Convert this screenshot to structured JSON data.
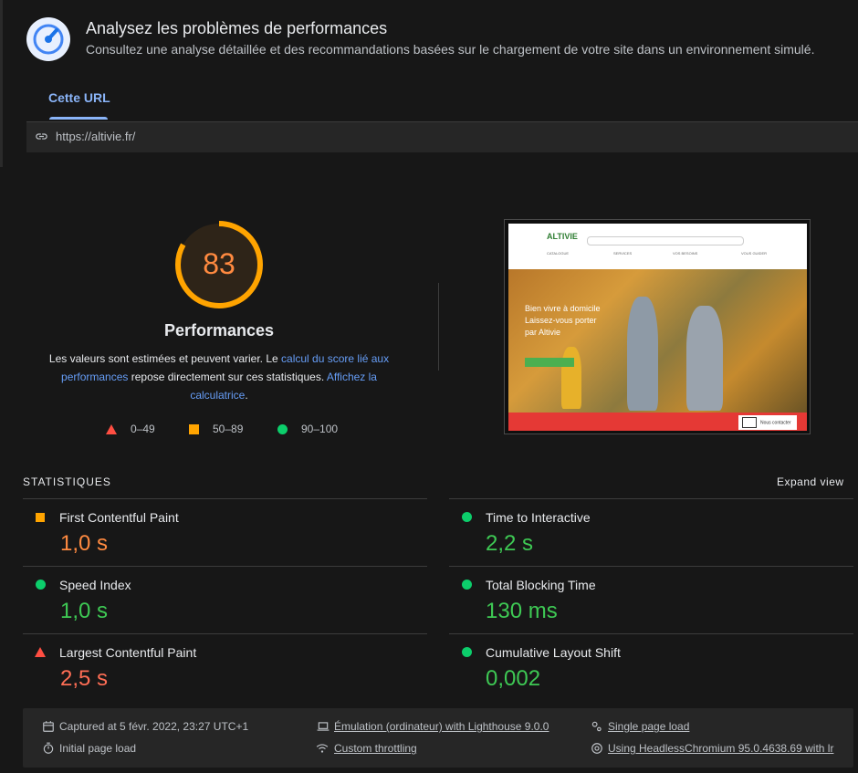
{
  "header": {
    "title": "Analysez les problèmes de performances",
    "subtitle": "Consultez une analyse détaillée et des recommandations basées sur le chargement de votre site dans un environnement simulé."
  },
  "tabs": [
    {
      "label": "Cette URL"
    }
  ],
  "url": "https://altivie.fr/",
  "score": {
    "value": "83",
    "fraction": 0.83,
    "label": "Performances",
    "desc_part1": "Les valeurs sont estimées et peuvent varier. Le ",
    "desc_link1": "calcul du score lié aux performances",
    "desc_part2": " repose directement sur ces statistiques. ",
    "desc_link2": "Affichez la calculatrice",
    "desc_part3": "."
  },
  "legend": [
    {
      "label": "0–49",
      "shape": "triangle",
      "color": "#ff4e42"
    },
    {
      "label": "50–89",
      "shape": "square",
      "color": "#ffa400"
    },
    {
      "label": "90–100",
      "shape": "circle",
      "color": "#0cce6b"
    }
  ],
  "thumbnail": {
    "logo": "ALTIVIE",
    "nav": [
      "CATALOGUE",
      "SERVICES",
      "VOS BESOINS",
      "VOUS GUIDER"
    ],
    "hero_lines": [
      "Bien vivre à domicile",
      "Laissez-vous porter",
      "par Altivie"
    ],
    "contact": "Nous contacter"
  },
  "stats": {
    "label": "STATISTIQUES",
    "expand": "Expand view",
    "metrics": [
      {
        "name": "First Contentful Paint",
        "value": "1,0 s",
        "rating": "average"
      },
      {
        "name": "Time to Interactive",
        "value": "2,2 s",
        "rating": "pass"
      },
      {
        "name": "Speed Index",
        "value": "1,0 s",
        "rating": "pass"
      },
      {
        "name": "Total Blocking Time",
        "value": "130 ms",
        "rating": "pass"
      },
      {
        "name": "Largest Contentful Paint",
        "value": "2,5 s",
        "rating": "fail"
      },
      {
        "name": "Cumulative Layout Shift",
        "value": "0,002",
        "rating": "pass"
      }
    ]
  },
  "footer": {
    "captured": "Captured at 5 févr. 2022, 23:27 UTC+1",
    "initial": "Initial page load",
    "emulation": "Émulation (ordinateur) with Lighthouse 9.0.0",
    "throttling": "Custom throttling",
    "single": "Single page load",
    "browser": "Using HeadlessChromium 95.0.4638.69 with lr"
  },
  "colors": {
    "accent": "#8ab4f8",
    "average": "#ffa400",
    "pass": "#0cce6b",
    "fail": "#ff4e42"
  }
}
